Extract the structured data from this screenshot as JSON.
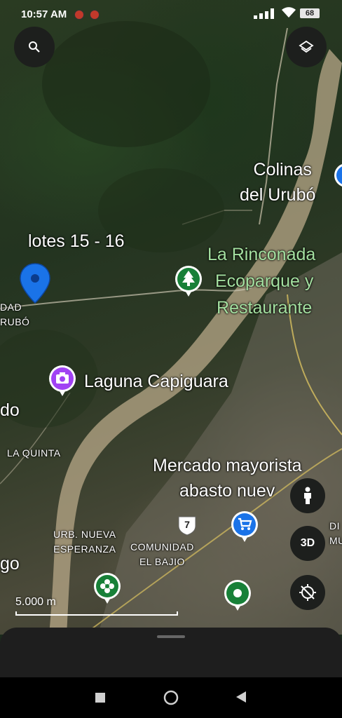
{
  "status_bar": {
    "time": "10:57 AM",
    "battery": "68",
    "icons": [
      "notification-red-icon",
      "notification-red-icon",
      "signal-icon",
      "wifi-icon",
      "battery-icon"
    ]
  },
  "controls": {
    "search_icon": "search-icon",
    "layers_icon": "layers-icon",
    "pegman_icon": "pegman-icon",
    "three_d_label": "3D",
    "compass_icon": "compass-icon"
  },
  "map": {
    "labels": {
      "colinas_line1": "Colinas",
      "colinas_line2": "del Urubó",
      "lotes": "lotes 15 - 16",
      "rinconada_line1": "La Rinconada",
      "rinconada_line2": "Ecoparque y",
      "rinconada_line3": "Restaurante",
      "edge_dad": "DAD",
      "edge_rubo": "RUBÓ",
      "laguna": "Laguna Capiguara",
      "edge_do": "do",
      "la_quinta": "LA QUINTA",
      "mercado_line1": "Mercado mayorista",
      "mercado_line2": "abasto nuev",
      "urb_line1": "URB. NUEVA",
      "urb_line2": "ESPERANZA",
      "comunidad_line1": "COMUNIDAD",
      "comunidad_line2": "EL BAJIO",
      "edge_go": "go",
      "edge_di": "DI",
      "edge_mun": "MUN",
      "route_number": "7"
    },
    "scale_text": "5.000 m",
    "colors": {
      "pin_blue": "#1a73e8",
      "pin_green": "#188038",
      "pin_purple": "#a142f4",
      "label_green": "#a4e0a0"
    }
  },
  "navigation_bar": {
    "icons": [
      "recents-square-icon",
      "home-circle-icon",
      "back-triangle-icon"
    ]
  }
}
